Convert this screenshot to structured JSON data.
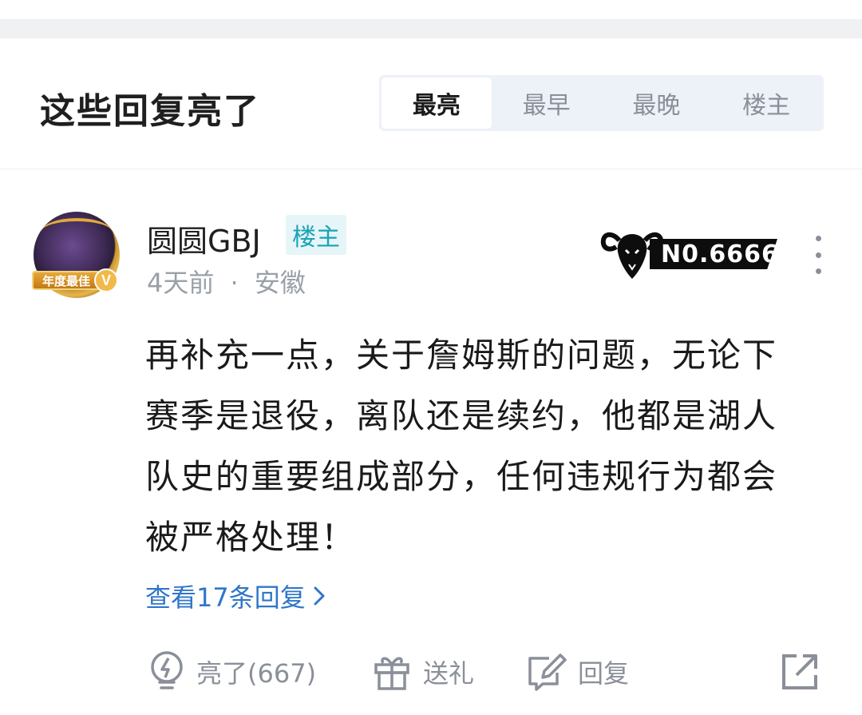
{
  "section": {
    "title": "这些回复亮了",
    "tabs": [
      {
        "label": "最亮",
        "active": true
      },
      {
        "label": "最早",
        "active": false
      },
      {
        "label": "最晚",
        "active": false
      },
      {
        "label": "楼主",
        "active": false
      }
    ]
  },
  "comment": {
    "username": "圆圆GBJ",
    "op_badge": "楼主",
    "avatar_ribbon": "年度最佳",
    "avatar_badge": "V",
    "time": "4天前",
    "separator": "·",
    "location": "安徽",
    "number_plate": "N0.6666",
    "content": "再补充一点，关于詹姆斯的问题，无论下赛季是退役，离队还是续约，他都是湖人队史的重要组成部分，任何违规行为都会被严格处理！",
    "view_replies": "查看17条回复",
    "actions": {
      "like_label": "亮了(667)",
      "gift_label": "送礼",
      "reply_label": "回复"
    }
  },
  "icons": {
    "like": "lightbulb-icon",
    "gift": "gift-icon",
    "reply": "edit-reply-icon",
    "share": "share-icon",
    "more": "more-vertical-icon",
    "plate": "goat-icon"
  },
  "colors": {
    "accent_link": "#2f76c9",
    "op_badge_bg": "#e6f5f8",
    "op_badge_text": "#1aa3b5",
    "muted": "#8a8f99"
  }
}
